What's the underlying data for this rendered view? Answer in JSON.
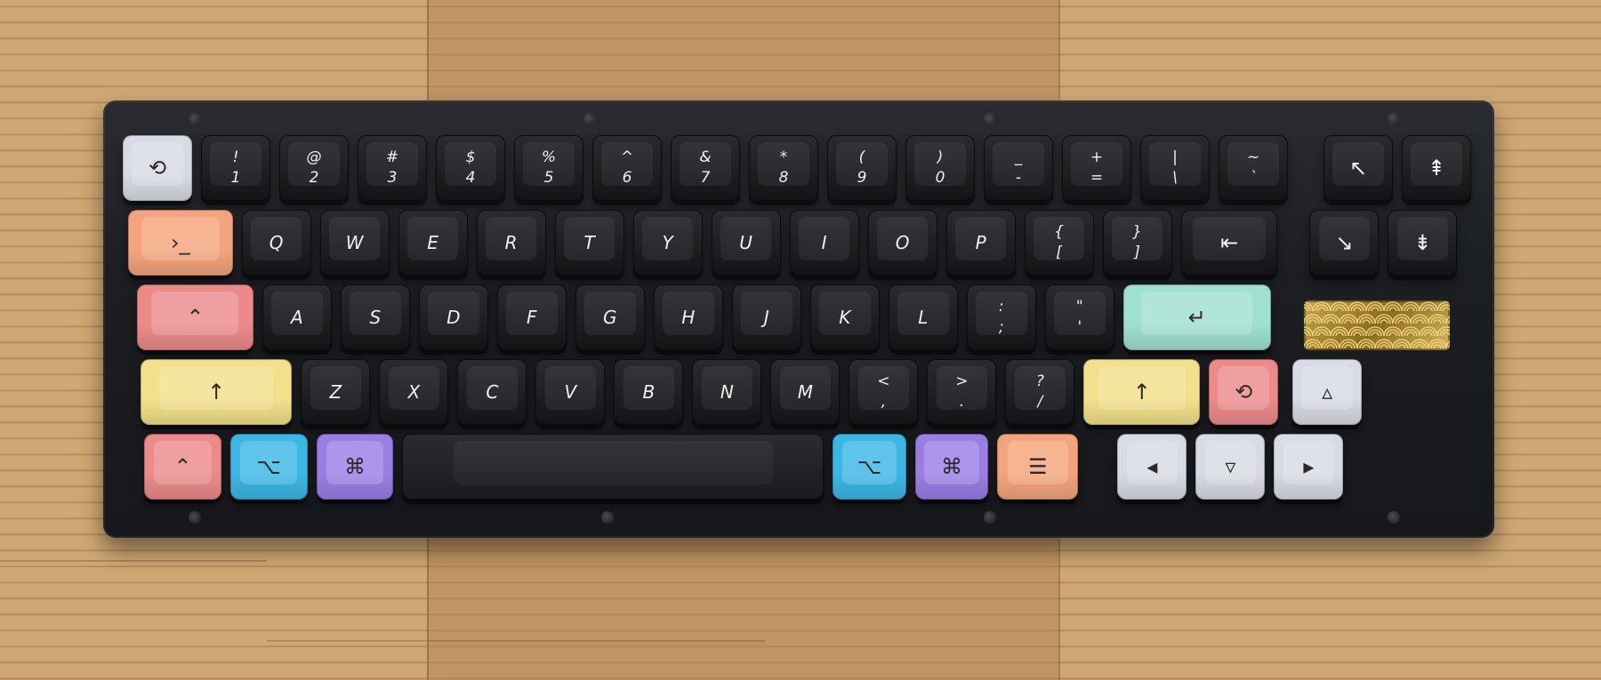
{
  "photo": {
    "subject": "keyboard",
    "colors": {
      "wood_light": "#cfa774",
      "wood_mid": "#c09563",
      "wood_dark": "#b0834f",
      "case": "#1c1e22",
      "key_dark": "#222226",
      "peach": "#f4a47c",
      "pink": "#ec8a8a",
      "yellow": "#f2e08a",
      "mint": "#9fe0cf",
      "blue": "#3bb7e6",
      "purple": "#9a7ee6",
      "gray": "#d8dbe3",
      "gold": "#c9a84a"
    }
  },
  "keyboard": {
    "rows": [
      [
        {
          "label": "",
          "icon": "reset-icon",
          "color": "gray"
        },
        {
          "label": "!\n1"
        },
        {
          "label": "@\n2"
        },
        {
          "label": "#\n3"
        },
        {
          "label": "$\n4"
        },
        {
          "label": "%\n5"
        },
        {
          "label": "^\n6"
        },
        {
          "label": "&\n7"
        },
        {
          "label": "*\n8"
        },
        {
          "label": "(\n9"
        },
        {
          "label": ")\n0"
        },
        {
          "label": "_\n-"
        },
        {
          "label": "+\n="
        },
        {
          "label": "|\n\\"
        },
        {
          "label": "~\n`"
        },
        {
          "label": "",
          "icon": "arrow-up-left-icon"
        },
        {
          "label": "",
          "icon": "page-up-icon"
        }
      ],
      [
        {
          "label": "",
          "icon": "terminal-icon",
          "color": "peach"
        },
        {
          "label": "Q"
        },
        {
          "label": "W"
        },
        {
          "label": "E"
        },
        {
          "label": "R"
        },
        {
          "label": "T"
        },
        {
          "label": "Y"
        },
        {
          "label": "U"
        },
        {
          "label": "I"
        },
        {
          "label": "O"
        },
        {
          "label": "P"
        },
        {
          "label": "{\n["
        },
        {
          "label": "}\n]"
        },
        {
          "label": "",
          "icon": "backspace-icon"
        },
        {
          "label": "",
          "icon": "arrow-down-right-icon"
        },
        {
          "label": "",
          "icon": "page-down-icon"
        }
      ],
      [
        {
          "label": "",
          "icon": "control-icon",
          "color": "pink"
        },
        {
          "label": "A"
        },
        {
          "label": "S"
        },
        {
          "label": "D"
        },
        {
          "label": "F"
        },
        {
          "label": "G"
        },
        {
          "label": "H"
        },
        {
          "label": "J"
        },
        {
          "label": "K"
        },
        {
          "label": "L"
        },
        {
          "label": ":\n;"
        },
        {
          "label": "\"\n'"
        },
        {
          "label": "",
          "icon": "return-icon",
          "color": "mint"
        }
      ],
      [
        {
          "label": "",
          "icon": "shift-icon",
          "color": "yellow"
        },
        {
          "label": "Z"
        },
        {
          "label": "X"
        },
        {
          "label": "C"
        },
        {
          "label": "V"
        },
        {
          "label": "B"
        },
        {
          "label": "N"
        },
        {
          "label": "M"
        },
        {
          "label": "<\n,"
        },
        {
          "label": ">\n."
        },
        {
          "label": "?\n/"
        },
        {
          "label": "",
          "icon": "shift-icon",
          "color": "yellow"
        },
        {
          "label": "",
          "icon": "reset-icon",
          "color": "pink"
        },
        {
          "label": "",
          "icon": "arrow-up-icon",
          "color": "gray"
        }
      ],
      [
        {
          "label": "",
          "icon": "control-icon",
          "color": "pink"
        },
        {
          "label": "",
          "icon": "option-icon",
          "color": "blue"
        },
        {
          "label": "",
          "icon": "command-icon",
          "color": "purple"
        },
        {
          "label": "",
          "icon": "spacebar",
          "color": "dark"
        },
        {
          "label": "",
          "icon": "option-icon",
          "color": "blue"
        },
        {
          "label": "",
          "icon": "command-icon",
          "color": "purple"
        },
        {
          "label": "",
          "icon": "menu-icon",
          "color": "peach"
        },
        {
          "label": "",
          "icon": "arrow-left-icon",
          "color": "gray"
        },
        {
          "label": "",
          "icon": "arrow-down-icon",
          "color": "gray"
        },
        {
          "label": "",
          "icon": "arrow-right-icon",
          "color": "gray"
        }
      ]
    ]
  }
}
